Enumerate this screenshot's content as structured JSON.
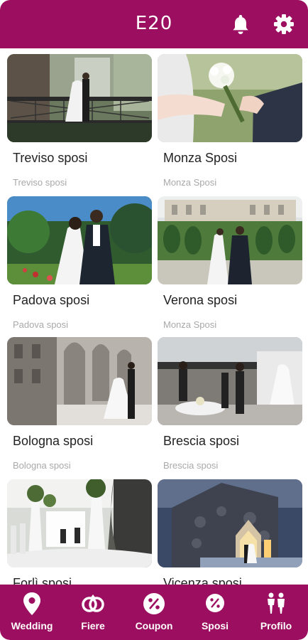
{
  "app": {
    "title": "E20"
  },
  "header": {
    "bell_icon": "bell-icon",
    "settings_icon": "gear-icon"
  },
  "cards": [
    {
      "title": "Treviso sposi",
      "subtitle": "Treviso sposi"
    },
    {
      "title": "Monza Sposi",
      "subtitle": "Monza Sposi"
    },
    {
      "title": "Padova sposi",
      "subtitle": "Padova sposi"
    },
    {
      "title": "Verona sposi",
      "subtitle": "Monza Sposi"
    },
    {
      "title": "Bologna sposi",
      "subtitle": "Bologna sposi"
    },
    {
      "title": "Brescia sposi",
      "subtitle": "Brescia sposi"
    },
    {
      "title": "Forlì sposi",
      "subtitle": ""
    },
    {
      "title": "Vicenza sposi",
      "subtitle": ""
    }
  ],
  "nav": [
    {
      "label": "Wedding",
      "icon": "location-pin-icon"
    },
    {
      "label": "Fiere",
      "icon": "rings-icon"
    },
    {
      "label": "Coupon",
      "icon": "percent-badge-icon"
    },
    {
      "label": "Sposi",
      "icon": "discount-tag-icon"
    },
    {
      "label": "Profilo",
      "icon": "couple-icon"
    }
  ],
  "colors": {
    "brand": "#9c0e5f",
    "text": "#222222",
    "subtext": "#a9a9a9"
  }
}
